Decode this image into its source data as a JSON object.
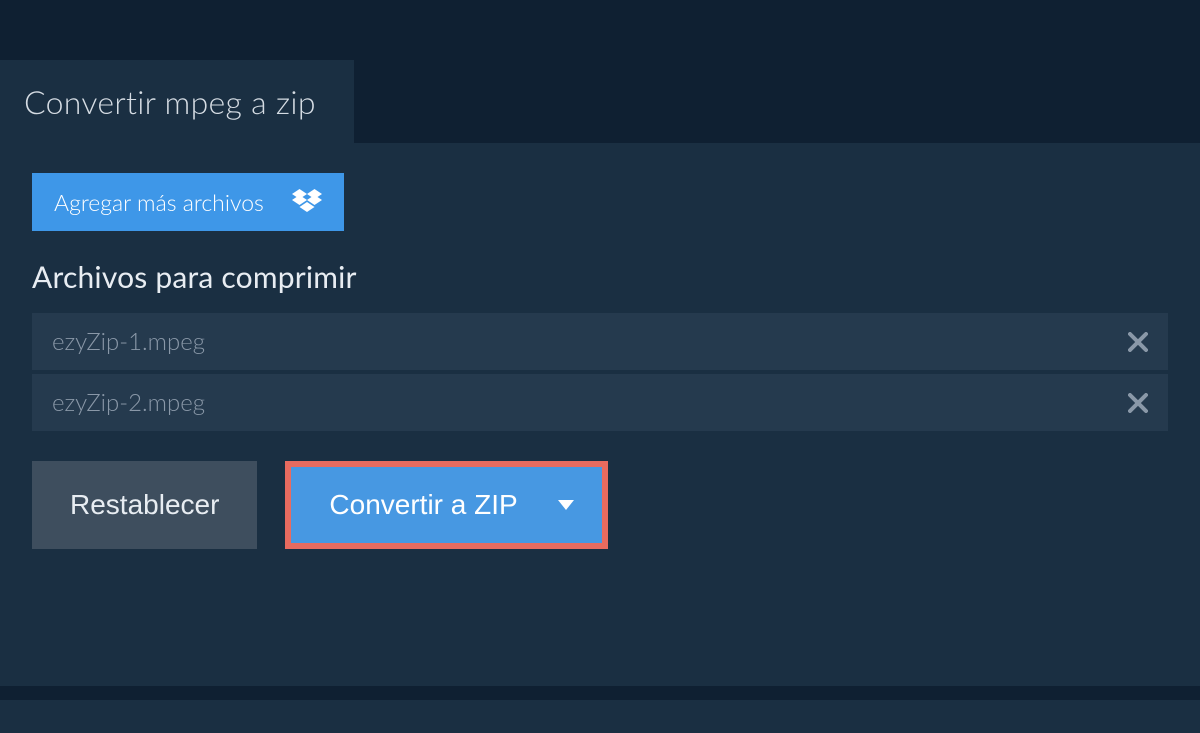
{
  "header": {
    "title": "Convertir mpeg a zip"
  },
  "addFiles": {
    "label": "Agregar más archivos"
  },
  "section": {
    "heading": "Archivos para comprimir"
  },
  "files": [
    {
      "name": "ezyZip-1.mpeg"
    },
    {
      "name": "ezyZip-2.mpeg"
    }
  ],
  "actions": {
    "reset": "Restablecer",
    "convert": "Convertir a ZIP"
  }
}
